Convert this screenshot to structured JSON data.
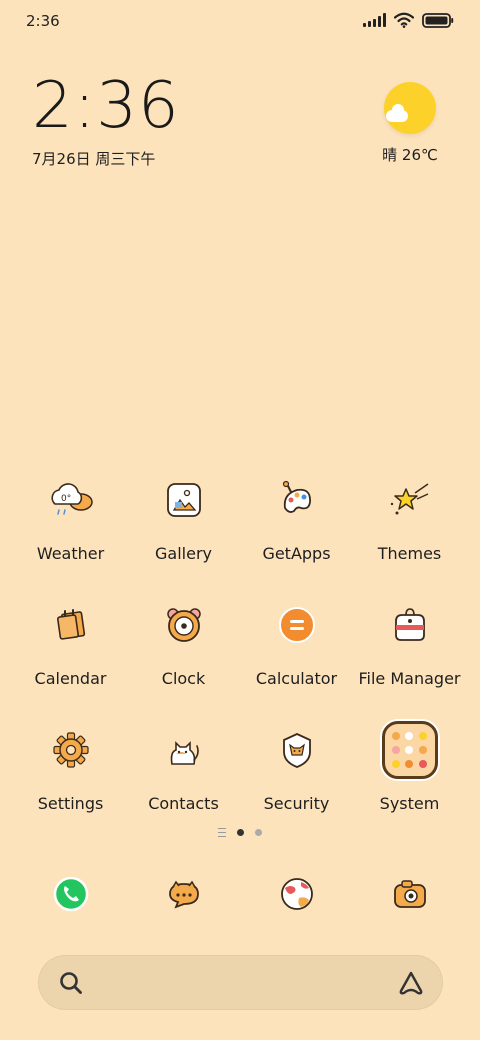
{
  "status_bar": {
    "time": "2:36"
  },
  "clock_widget": {
    "time": "2:36",
    "date": "7月26日 周三下午"
  },
  "weather_widget": {
    "text": "晴 26℃",
    "icon": "sunny-cloud-icon"
  },
  "apps": [
    {
      "label": "Weather",
      "icon": "weather-icon"
    },
    {
      "label": "Gallery",
      "icon": "gallery-icon"
    },
    {
      "label": "GetApps",
      "icon": "getapps-icon"
    },
    {
      "label": "Themes",
      "icon": "themes-icon"
    },
    {
      "label": "Calendar",
      "icon": "calendar-icon"
    },
    {
      "label": "Clock",
      "icon": "clock-icon"
    },
    {
      "label": "Calculator",
      "icon": "calculator-icon"
    },
    {
      "label": "File Manager",
      "icon": "file-manager-icon"
    },
    {
      "label": "Settings",
      "icon": "settings-icon"
    },
    {
      "label": "Contacts",
      "icon": "contacts-icon"
    },
    {
      "label": "Security",
      "icon": "security-icon"
    },
    {
      "label": "System",
      "icon": "system-folder-icon"
    }
  ],
  "dock": [
    {
      "icon": "phone-icon"
    },
    {
      "icon": "messages-icon"
    },
    {
      "icon": "browser-icon"
    },
    {
      "icon": "camera-icon"
    }
  ],
  "page_indicator": {
    "active_page": 1,
    "pages": 2
  },
  "colors": {
    "background": "#fde3bc",
    "sun": "#fcd22a",
    "accent_orange": "#f28c2e",
    "phone_green": "#22c55e",
    "search_bar": "#ecd4ac"
  }
}
